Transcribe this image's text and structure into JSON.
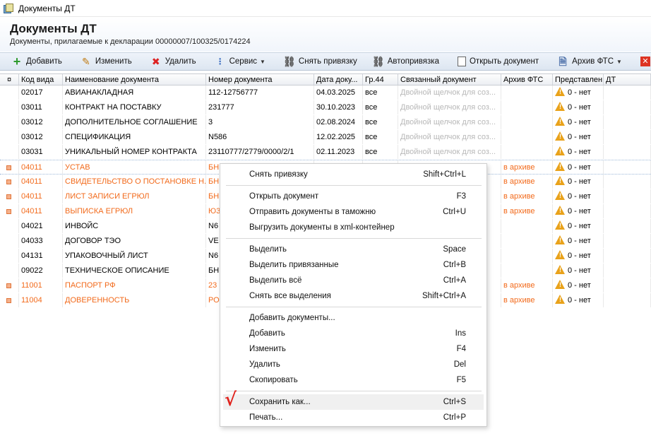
{
  "window": {
    "title": "Документы ДТ"
  },
  "header": {
    "title": "Документы ДТ",
    "subtitle": "Документы, прилагаемые к декларации 00000007/100325/0174224"
  },
  "toolbar": {
    "add": "Добавить",
    "edit": "Изменить",
    "delete": "Удалить",
    "service": "Сервис",
    "unlink": "Снять привязку",
    "autolink": "Автопривязка",
    "open_doc": "Открыть документ",
    "archive": "Архив ФТС"
  },
  "columns": {
    "marker": "¤",
    "code": "Код вида",
    "name": "Наименование документа",
    "number": "Номер документа",
    "date": "Дата доку...",
    "gr44": "Гр.44",
    "linked": "Связанный документ",
    "archive": "Архив ФТС",
    "presented": "Представлен",
    "dt": "ДТ"
  },
  "rows": [
    {
      "code": "02017",
      "name": "АВИАНАКЛАДНАЯ",
      "number": "112-12756777",
      "date": "04.03.2025",
      "gr44": "все",
      "linked": "Двойной щелчок для соз...",
      "archive": "",
      "presented": "0 - нет"
    },
    {
      "code": "03011",
      "name": "КОНТРАКТ НА ПОСТАВКУ",
      "number": "231777",
      "date": "30.10.2023",
      "gr44": "все",
      "linked": "Двойной щелчок для соз...",
      "archive": "",
      "presented": "0 - нет"
    },
    {
      "code": "03012",
      "name": "ДОПОЛНИТЕЛЬНОЕ СОГЛАШЕНИЕ",
      "number": "3",
      "date": "02.08.2024",
      "gr44": "все",
      "linked": "Двойной щелчок для соз...",
      "archive": "",
      "presented": "0 - нет"
    },
    {
      "code": "03012",
      "name": "СПЕЦИФИКАЦИЯ",
      "number": "N586",
      "date": "12.02.2025",
      "gr44": "все",
      "linked": "Двойной щелчок для соз...",
      "archive": "",
      "presented": "0 - нет"
    },
    {
      "code": "03031",
      "name": "УНИКАЛЬНЫЙ НОМЕР КОНТРАКТА",
      "number": "23110777/2779/0000/2/1",
      "date": "02.11.2023",
      "gr44": "все",
      "linked": "Двойной щелчок для соз...",
      "archive": "",
      "presented": "0 - нет"
    },
    {
      "code": "04011",
      "name": "УСТАВ",
      "number": "БН",
      "date": "",
      "gr44": "",
      "linked": "",
      "archive": "в архиве",
      "presented": "0 - нет"
    },
    {
      "code": "04011",
      "name": "СВИДЕТЕЛЬСТВО О ПОСТАНОВКЕ Н...",
      "number": "БН",
      "date": "",
      "gr44": "",
      "linked": "",
      "archive": "в архиве",
      "presented": "0 - нет"
    },
    {
      "code": "04011",
      "name": "ЛИСТ ЗАПИСИ ЕГРЮЛ",
      "number": "БН",
      "date": "",
      "gr44": "",
      "linked": "",
      "archive": "в архиве",
      "presented": "0 - нет"
    },
    {
      "code": "04011",
      "name": "ВЫПИСКА ЕГРЮЛ",
      "number": "Ю3",
      "date": "",
      "gr44": "",
      "linked": "",
      "archive": "в архиве",
      "presented": "0 - нет"
    },
    {
      "code": "04021",
      "name": "ИНВОЙС",
      "number": "N6",
      "date": "",
      "gr44": "",
      "linked": "",
      "archive": "",
      "presented": "0 - нет"
    },
    {
      "code": "04033",
      "name": "ДОГОВОР ТЭО",
      "number": "VE",
      "date": "",
      "gr44": "",
      "linked": "",
      "archive": "",
      "presented": "0 - нет"
    },
    {
      "code": "04131",
      "name": "УПАКОВОЧНЫЙ ЛИСТ",
      "number": "N6",
      "date": "",
      "gr44": "",
      "linked": "",
      "archive": "",
      "presented": "0 - нет"
    },
    {
      "code": "09022",
      "name": "ТЕХНИЧЕСКОЕ ОПИСАНИЕ",
      "number": "БН",
      "date": "",
      "gr44": "",
      "linked": "",
      "archive": "",
      "presented": "0 - нет"
    },
    {
      "code": "11001",
      "name": "ПАСПОРТ РФ",
      "number": "23",
      "date": "",
      "gr44": "",
      "linked": "",
      "archive": "в архиве",
      "presented": "0 - нет"
    },
    {
      "code": "11004",
      "name": "ДОВЕРЕННОСТЬ",
      "number": "РО",
      "date": "",
      "gr44": "",
      "linked": "",
      "archive": "в архиве",
      "presented": "0 - нет"
    }
  ],
  "context_menu": {
    "groups": [
      [
        {
          "label": "Снять привязку",
          "shortcut": "Shift+Ctrl+L"
        }
      ],
      [
        {
          "label": "Открыть документ",
          "shortcut": "F3"
        },
        {
          "label": "Отправить документы в таможню",
          "shortcut": "Ctrl+U"
        },
        {
          "label": "Выгрузить документы в xml-контейнер",
          "shortcut": ""
        }
      ],
      [
        {
          "label": "Выделить",
          "shortcut": "Space"
        },
        {
          "label": "Выделить привязанные",
          "shortcut": "Ctrl+B"
        },
        {
          "label": "Выделить всё",
          "shortcut": "Ctrl+A"
        },
        {
          "label": "Снять все выделения",
          "shortcut": "Shift+Ctrl+A"
        }
      ],
      [
        {
          "label": "Добавить документы...",
          "shortcut": ""
        },
        {
          "label": "Добавить",
          "shortcut": "Ins"
        },
        {
          "label": "Изменить",
          "shortcut": "F4"
        },
        {
          "label": "Удалить",
          "shortcut": "Del"
        },
        {
          "label": "Скопировать",
          "shortcut": "F5"
        }
      ],
      [
        {
          "label": "Сохранить как...",
          "shortcut": "Ctrl+S"
        },
        {
          "label": "Печать...",
          "shortcut": "Ctrl+P"
        }
      ]
    ]
  },
  "annotation": {
    "mark": "√",
    "color": "#e0201a"
  },
  "colors": {
    "archived_row": "#f26a1b",
    "linked_hint": "#b8b8b8",
    "warning": "#e9a21a"
  }
}
